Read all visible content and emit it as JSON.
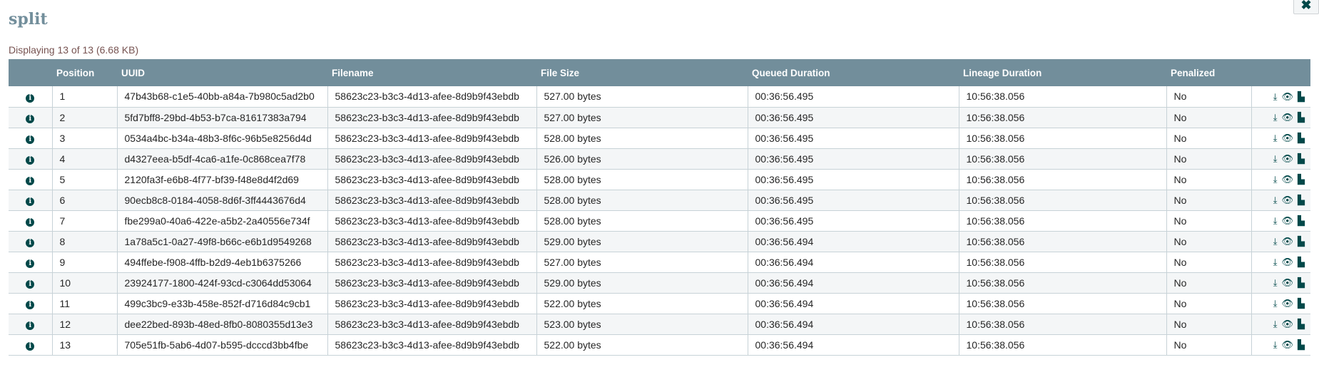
{
  "title": "split",
  "close_icon": "times-icon",
  "summary": "Displaying 13 of 13 (6.68 KB)",
  "columns": [
    "",
    "Position",
    "UUID",
    "Filename",
    "File Size",
    "Queued Duration",
    "Lineage Duration",
    "Penalized",
    ""
  ],
  "rows": [
    {
      "position": "1",
      "uuid": "47b43b68-c1e5-40bb-a84a-7b980c5ad2b0",
      "filename": "58623c23-b3c3-4d13-afee-8d9b9f43ebdb",
      "size": "527.00 bytes",
      "queued": "00:36:56.495",
      "lineage": "10:56:38.056",
      "penalized": "No"
    },
    {
      "position": "2",
      "uuid": "5fd7bff8-29bd-4b53-b7ca-81617383a794",
      "filename": "58623c23-b3c3-4d13-afee-8d9b9f43ebdb",
      "size": "527.00 bytes",
      "queued": "00:36:56.495",
      "lineage": "10:56:38.056",
      "penalized": "No"
    },
    {
      "position": "3",
      "uuid": "0534a4bc-b34a-48b3-8f6c-96b5e8256d4d",
      "filename": "58623c23-b3c3-4d13-afee-8d9b9f43ebdb",
      "size": "528.00 bytes",
      "queued": "00:36:56.495",
      "lineage": "10:56:38.056",
      "penalized": "No"
    },
    {
      "position": "4",
      "uuid": "d4327eea-b5df-4ca6-a1fe-0c868cea7f78",
      "filename": "58623c23-b3c3-4d13-afee-8d9b9f43ebdb",
      "size": "526.00 bytes",
      "queued": "00:36:56.495",
      "lineage": "10:56:38.056",
      "penalized": "No"
    },
    {
      "position": "5",
      "uuid": "2120fa3f-e6b8-4f77-bf39-f48e8d4f2d69",
      "filename": "58623c23-b3c3-4d13-afee-8d9b9f43ebdb",
      "size": "528.00 bytes",
      "queued": "00:36:56.495",
      "lineage": "10:56:38.056",
      "penalized": "No"
    },
    {
      "position": "6",
      "uuid": "90ecb8c8-0184-4058-8d6f-3ff4443676d4",
      "filename": "58623c23-b3c3-4d13-afee-8d9b9f43ebdb",
      "size": "528.00 bytes",
      "queued": "00:36:56.495",
      "lineage": "10:56:38.056",
      "penalized": "No"
    },
    {
      "position": "7",
      "uuid": "fbe299a0-40a6-422e-a5b2-2a40556e734f",
      "filename": "58623c23-b3c3-4d13-afee-8d9b9f43ebdb",
      "size": "528.00 bytes",
      "queued": "00:36:56.495",
      "lineage": "10:56:38.056",
      "penalized": "No"
    },
    {
      "position": "8",
      "uuid": "1a78a5c1-0a27-49f8-b66c-e6b1d9549268",
      "filename": "58623c23-b3c3-4d13-afee-8d9b9f43ebdb",
      "size": "529.00 bytes",
      "queued": "00:36:56.494",
      "lineage": "10:56:38.056",
      "penalized": "No"
    },
    {
      "position": "9",
      "uuid": "494ffebe-f908-4ffb-b2d9-4eb1b6375266",
      "filename": "58623c23-b3c3-4d13-afee-8d9b9f43ebdb",
      "size": "527.00 bytes",
      "queued": "00:36:56.494",
      "lineage": "10:56:38.056",
      "penalized": "No"
    },
    {
      "position": "10",
      "uuid": "23924177-1800-424f-93cd-c3064dd53064",
      "filename": "58623c23-b3c3-4d13-afee-8d9b9f43ebdb",
      "size": "529.00 bytes",
      "queued": "00:36:56.494",
      "lineage": "10:56:38.056",
      "penalized": "No"
    },
    {
      "position": "11",
      "uuid": "499c3bc9-e33b-458e-852f-d716d84c9cb1",
      "filename": "58623c23-b3c3-4d13-afee-8d9b9f43ebdb",
      "size": "522.00 bytes",
      "queued": "00:36:56.494",
      "lineage": "10:56:38.056",
      "penalized": "No"
    },
    {
      "position": "12",
      "uuid": "dee22bed-893b-48ed-8fb0-8080355d13e3",
      "filename": "58623c23-b3c3-4d13-afee-8d9b9f43ebdb",
      "size": "523.00 bytes",
      "queued": "00:36:56.494",
      "lineage": "10:56:38.056",
      "penalized": "No"
    },
    {
      "position": "13",
      "uuid": "705e51fb-5ab6-4d07-b595-dcccd3bb4fbe",
      "filename": "58623c23-b3c3-4d13-afee-8d9b9f43ebdb",
      "size": "522.00 bytes",
      "queued": "00:36:56.494",
      "lineage": "10:56:38.056",
      "penalized": "No"
    }
  ],
  "row_icons": [
    "info-icon",
    "download-icon",
    "eye-icon",
    "provenance-icon"
  ]
}
